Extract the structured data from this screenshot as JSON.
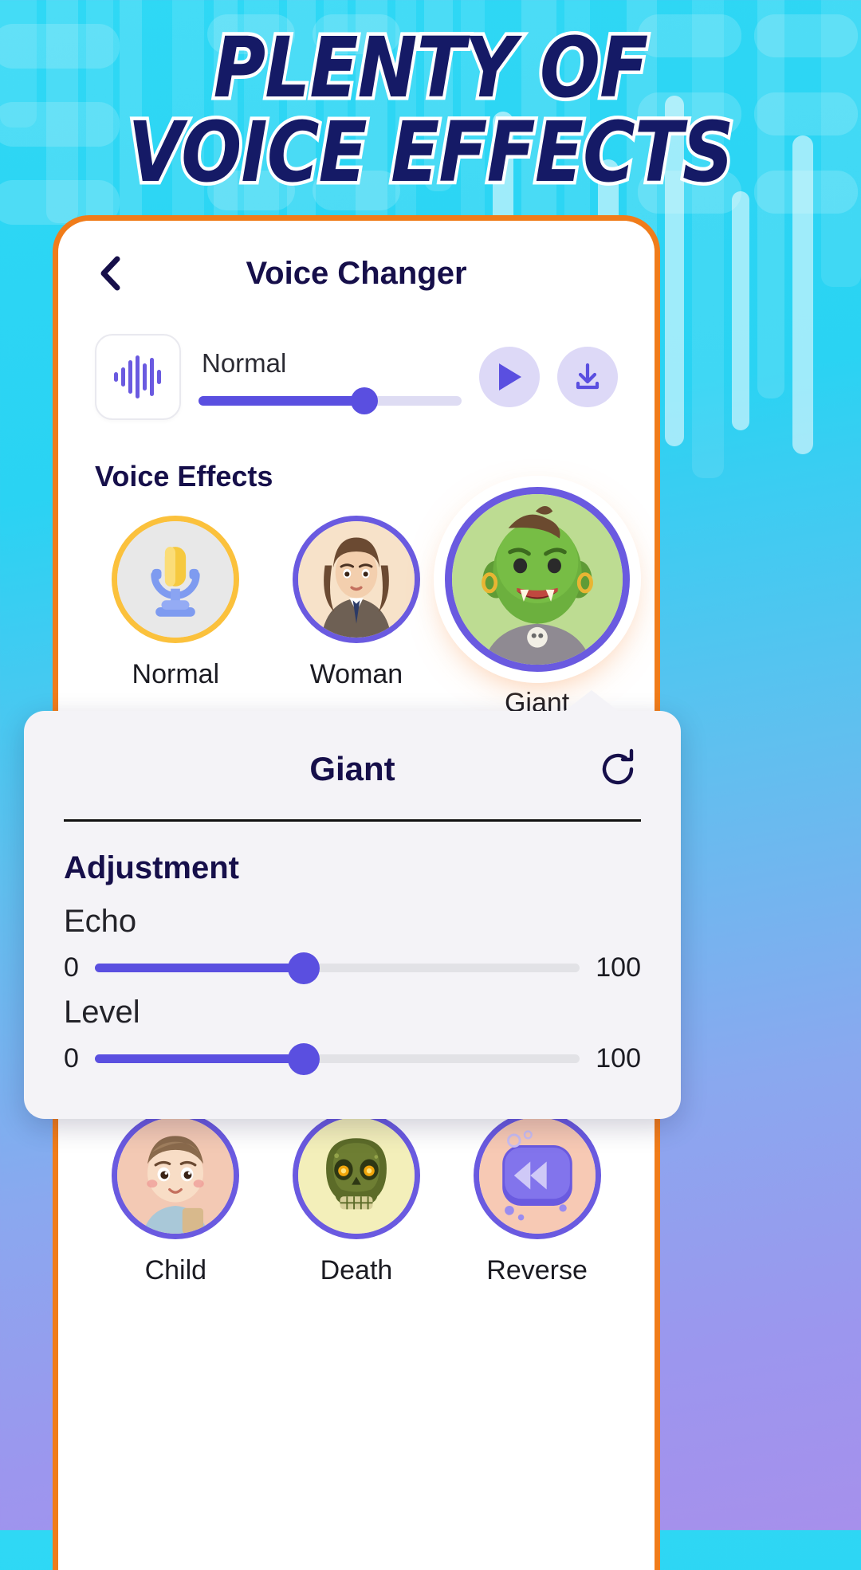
{
  "promo": {
    "headline_line1": "PLENTY OF",
    "headline_line2": "VOICE EFFECTS",
    "headline_color": "#151a66",
    "headline_outline": "#ffffff",
    "background_start": "#2fd8f5",
    "background_end": "#a690ec",
    "frame_color": "#f07c1a"
  },
  "appbar": {
    "back_icon": "chevron-left-icon",
    "title": "Voice Changer"
  },
  "player": {
    "wave_icon": "audio-waveform-icon",
    "preset_label": "Normal",
    "progress_percent": 63,
    "play_icon": "play-icon",
    "download_icon": "download-icon",
    "accent": "#5a4fe0",
    "track_bg": "#dedcf3",
    "button_bg": "#ddd9f7"
  },
  "effects": {
    "section_title": "Voice Effects",
    "selected": "Giant",
    "row1": [
      {
        "label": "Normal",
        "icon": "microphone-avatar",
        "ring": "#fbc13c",
        "selected": false
      },
      {
        "label": "Woman",
        "icon": "woman-avatar",
        "ring": "#6a5ae0",
        "selected": false
      },
      {
        "label": "Giant",
        "icon": "giant-orc-avatar",
        "ring": "#6a5ae0",
        "selected": true
      }
    ],
    "row2": [
      {
        "label": "Child",
        "icon": "child-avatar",
        "ring": "#6a5ae0",
        "selected": false
      },
      {
        "label": "Death",
        "icon": "skull-avatar",
        "ring": "#6a5ae0",
        "selected": false
      },
      {
        "label": "Reverse",
        "icon": "reverse-avatar",
        "ring": "#6a5ae0",
        "selected": false
      }
    ]
  },
  "sheet": {
    "title": "Giant",
    "refresh_icon": "refresh-icon",
    "adjustment_title": "Adjustment",
    "controls": [
      {
        "name": "Echo",
        "min": "0",
        "max": "100",
        "value_percent": 43
      },
      {
        "name": "Level",
        "min": "0",
        "max": "100",
        "value_percent": 43
      }
    ]
  }
}
